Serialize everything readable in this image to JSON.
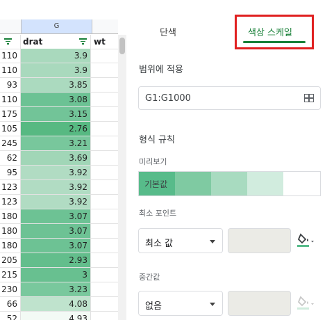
{
  "sheet": {
    "column_letter": "G",
    "headers": {
      "left": "",
      "drat": "drat",
      "wt": "wt"
    },
    "rows": [
      {
        "left": "110",
        "drat": "3.9",
        "color": "#a9d9bd"
      },
      {
        "left": "110",
        "drat": "3.9",
        "color": "#a9d9bd"
      },
      {
        "left": "93",
        "drat": "3.85",
        "color": "#abdabf"
      },
      {
        "left": "110",
        "drat": "3.08",
        "color": "#6cc294"
      },
      {
        "left": "175",
        "drat": "3.15",
        "color": "#72c498"
      },
      {
        "left": "105",
        "drat": "2.76",
        "color": "#57b982"
      },
      {
        "left": "245",
        "drat": "3.21",
        "color": "#78c79c"
      },
      {
        "left": "62",
        "drat": "3.69",
        "color": "#a1d6b7"
      },
      {
        "left": "95",
        "drat": "3.92",
        "color": "#b1dcc3"
      },
      {
        "left": "123",
        "drat": "3.92",
        "color": "#b1dcc3"
      },
      {
        "left": "123",
        "drat": "3.92",
        "color": "#b1dcc3"
      },
      {
        "left": "180",
        "drat": "3.07",
        "color": "#6dc294"
      },
      {
        "left": "180",
        "drat": "3.07",
        "color": "#6dc294"
      },
      {
        "left": "180",
        "drat": "3.07",
        "color": "#6dc294"
      },
      {
        "left": "205",
        "drat": "2.93",
        "color": "#63be8c"
      },
      {
        "left": "215",
        "drat": "3",
        "color": "#68c090"
      },
      {
        "left": "230",
        "drat": "3.23",
        "color": "#79c89d"
      },
      {
        "left": "66",
        "drat": "4.08",
        "color": "#bfe3cd"
      },
      {
        "left": "52",
        "drat": "4.93",
        "color": "#f3faf5"
      }
    ]
  },
  "panel": {
    "tab_single": "단색",
    "tab_color_scale": "색상 스케일",
    "apply_range_label": "범위에 적용",
    "range_value": "G1:G1000",
    "format_rules_label": "형식 규칙",
    "preview_label": "미리보기",
    "preview_text": "기본값",
    "preview_colors": [
      "#57bb8a",
      "#7fcaa2",
      "#a8dbc0",
      "#d1ecde",
      "#ffffff"
    ],
    "min_point_label": "최소 포인트",
    "min_point_value": "최소 값",
    "midpoint_label": "중간값",
    "midpoint_value": "없음",
    "accent_color": "#188038",
    "highlight_color": "#e02020"
  }
}
